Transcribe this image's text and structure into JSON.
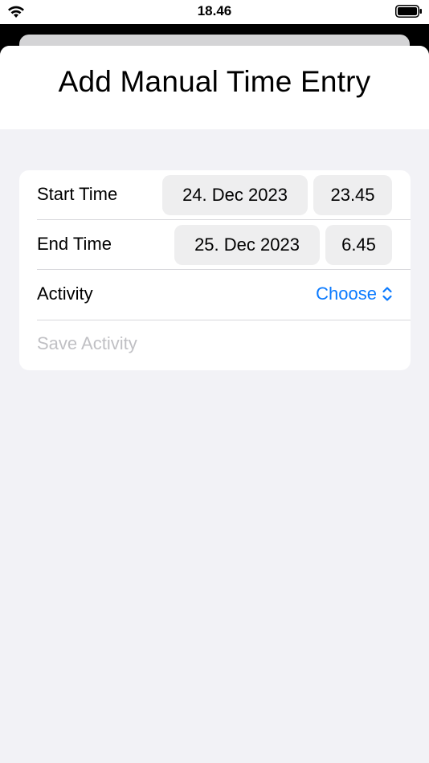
{
  "status_bar": {
    "time": "18.46",
    "icons": [
      "wifi-icon",
      "battery-icon"
    ]
  },
  "sheet": {
    "title": "Add Manual Time Entry"
  },
  "form": {
    "start_time": {
      "label": "Start Time",
      "date": "24. Dec 2023",
      "time": "23.45"
    },
    "end_time": {
      "label": "End Time",
      "date": "25. Dec 2023",
      "time": "6.45"
    },
    "activity": {
      "label": "Activity",
      "value": "Choose",
      "icon": "chevron-up-down-icon"
    },
    "save": {
      "label": "Save Activity",
      "enabled": false
    }
  },
  "colors": {
    "accent": "#0a7aff",
    "disabled_text": "#c0c0c4",
    "background": "#f2f2f6"
  }
}
